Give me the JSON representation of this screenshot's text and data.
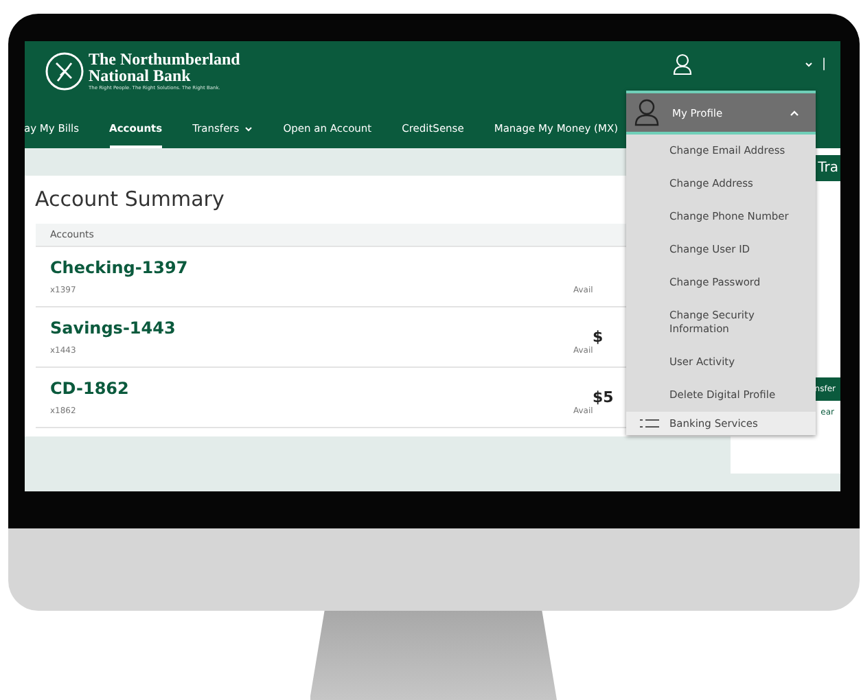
{
  "bank": {
    "name_line_1": "The Northumberland",
    "name_line_2": "National Bank",
    "tagline": "The Right People. The Right Solutions. The Right Bank."
  },
  "nav": [
    {
      "label": "ay My Bills",
      "selected": false,
      "has_menu": false
    },
    {
      "label": "Accounts",
      "selected": true,
      "has_menu": false
    },
    {
      "label": "Transfers",
      "selected": false,
      "has_menu": true
    },
    {
      "label": "Open an Account",
      "selected": false,
      "has_menu": false
    },
    {
      "label": "CreditSense",
      "selected": false,
      "has_menu": false
    },
    {
      "label": "Manage My Money (MX)",
      "selected": false,
      "has_menu": false
    }
  ],
  "header_right": {
    "separator": "|"
  },
  "summary": {
    "title": "Account Summary",
    "column": "Accounts",
    "accounts": [
      {
        "name": "Checking-1397",
        "number": "x1397",
        "balance_label": "Avail"
      },
      {
        "name": "Savings-1443",
        "number": "x1443",
        "balance": "$",
        "balance_label": "Avail"
      },
      {
        "name": "CD-1862",
        "number": "x1862",
        "balance": "$5",
        "balance_label": "Avail"
      }
    ]
  },
  "side_panel": {
    "title": "Tra",
    "button": "nsfer",
    "link": "ear"
  },
  "profile_menu": {
    "title": "My Profile",
    "expanded": true,
    "items": [
      "Change Email Address",
      "Change Address",
      "Change Phone Number",
      "Change User ID",
      "Change Password",
      "Change Security Information",
      "User Activity",
      "Delete Digital Profile"
    ],
    "next_section": "Banking Services"
  }
}
